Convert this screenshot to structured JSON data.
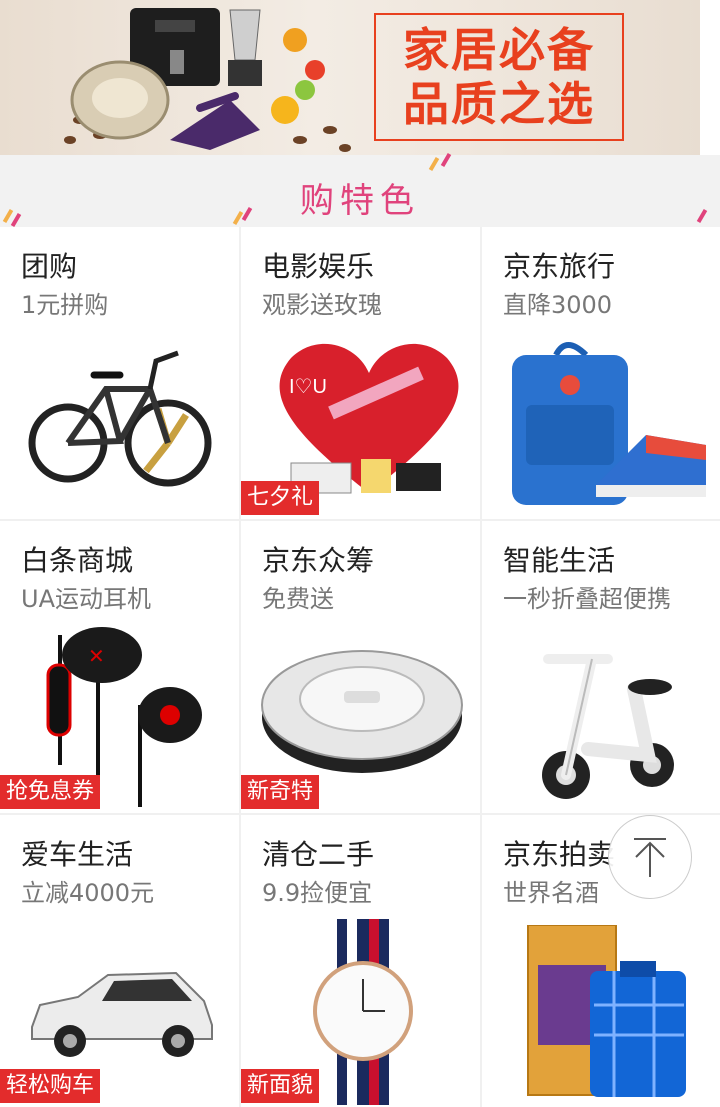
{
  "banner": {
    "line1": "家居必备",
    "line2": "品质之选"
  },
  "section_title": "购特色",
  "items": [
    {
      "name": "团购",
      "sub": "1元拼购",
      "tag": "",
      "icon": "bicycle-icon"
    },
    {
      "name": "电影娱乐",
      "sub": "观影送玫瑰",
      "tag": "七夕礼",
      "icon": "rose-heart-icon"
    },
    {
      "name": "京东旅行",
      "sub": "直降3000",
      "tag": "",
      "icon": "backpack-icon"
    },
    {
      "name": "白条商城",
      "sub": "UA运动耳机",
      "tag": "抢免息券",
      "icon": "earphones-icon"
    },
    {
      "name": "京东众筹",
      "sub": "免费送",
      "tag": "新奇特",
      "icon": "robot-vacuum-icon"
    },
    {
      "name": "智能生活",
      "sub": "一秒折叠超便携",
      "tag": "",
      "icon": "scooter-icon"
    },
    {
      "name": "爱车生活",
      "sub": "立减4000元",
      "tag": "轻松购车",
      "icon": "suv-icon"
    },
    {
      "name": "清仓二手",
      "sub": "9.9捡便宜",
      "tag": "新面貌",
      "icon": "watch-icon"
    },
    {
      "name": "京东拍卖",
      "sub": "世界名酒",
      "tag": "",
      "icon": "liquor-box-icon"
    }
  ],
  "colors": {
    "accent_pink": "#e0437c",
    "tag_red": "#e32c2c",
    "banner_red": "#e8401e"
  }
}
